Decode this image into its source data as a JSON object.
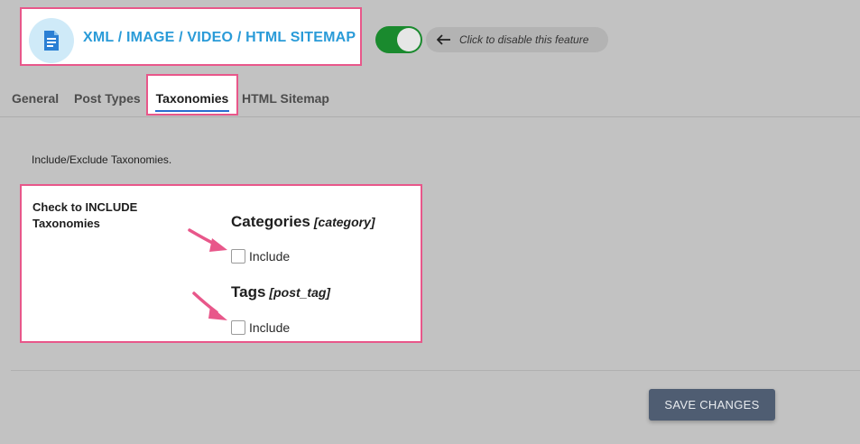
{
  "header": {
    "title": "XML / IMAGE / VIDEO / HTML SITEMAP",
    "logo_icon": "sitemap-document-icon"
  },
  "feature_toggle": {
    "state": "on",
    "hint": "Click to disable this feature",
    "hint_icon": "arrow-left-icon"
  },
  "tabs": [
    {
      "label": "General"
    },
    {
      "label": "Post Types"
    },
    {
      "label": "Taxonomies",
      "active": true
    },
    {
      "label": "HTML Sitemap"
    }
  ],
  "intro": "Include/Exclude Taxonomies.",
  "settings": {
    "label": "Check to INCLUDE Taxonomies",
    "taxonomies": [
      {
        "name": "Categories",
        "slug": "[category]",
        "checkbox_label": "Include",
        "checked": false
      },
      {
        "name": "Tags",
        "slug": "[post_tag]",
        "checkbox_label": "Include",
        "checked": false
      }
    ]
  },
  "save_button": "SAVE CHANGES",
  "colors": {
    "accent_blue": "#2a9bd8",
    "highlight_pink": "#e8578a",
    "toggle_green": "#1a8a2e",
    "button_bg": "#4f5d72"
  }
}
